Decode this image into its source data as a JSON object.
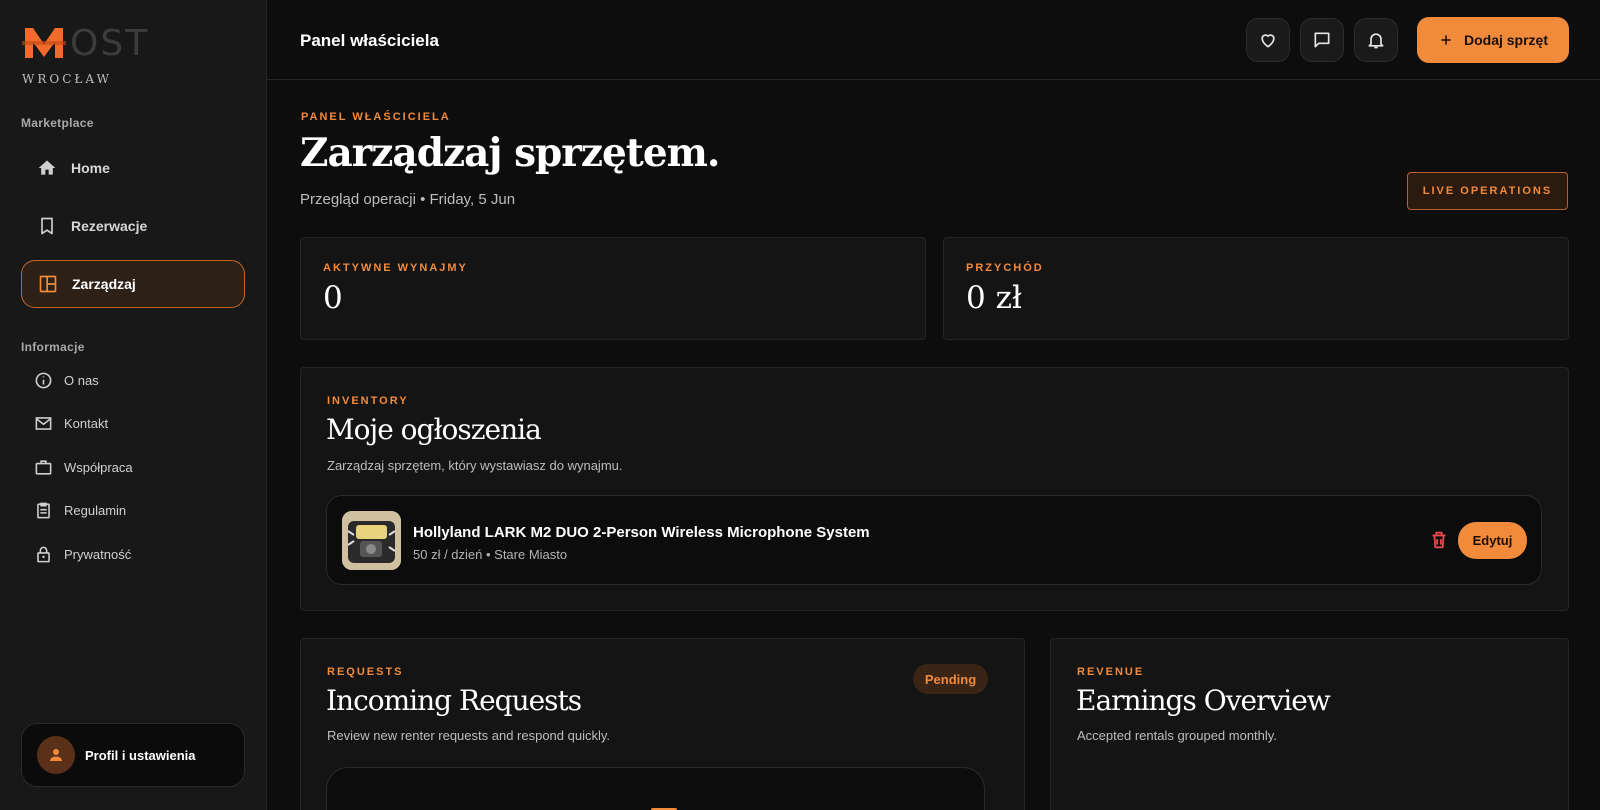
{
  "brand": {
    "logo_text": "OST",
    "city": "WROCŁAW"
  },
  "sidebar": {
    "marketplace_label": "Marketplace",
    "nav": [
      {
        "label": "Home",
        "icon": "home-icon"
      },
      {
        "label": "Rezerwacje",
        "icon": "bookmark-icon"
      },
      {
        "label": "Zarządzaj",
        "icon": "dashboard-icon",
        "active": true
      }
    ],
    "info_label": "Informacje",
    "info_items": [
      {
        "label": "O nas",
        "icon": "info-icon"
      },
      {
        "label": "Kontakt",
        "icon": "mail-icon"
      },
      {
        "label": "Współpraca",
        "icon": "briefcase-icon"
      },
      {
        "label": "Regulamin",
        "icon": "clipboard-icon"
      },
      {
        "label": "Prywatność",
        "icon": "lock-icon"
      }
    ],
    "profile_label": "Profil i ustawienia"
  },
  "topbar": {
    "title": "Panel właściciela",
    "add_button_label": "Dodaj sprzęt"
  },
  "hero": {
    "eyebrow": "PANEL WŁAŚCICIELA",
    "title": "Zarządzaj sprzętem.",
    "subtitle": "Przegląd operacji • Friday, 5 Jun",
    "live_badge": "LIVE OPERATIONS"
  },
  "stats": [
    {
      "label": "AKTYWNE WYNAJMY",
      "value": "0"
    },
    {
      "label": "PRZYCHÓD",
      "value": "0 zł"
    }
  ],
  "inventory": {
    "eyebrow": "INVENTORY",
    "title": "Moje ogłoszenia",
    "description": "Zarządzaj sprzętem, który wystawiasz do wynajmu.",
    "listings": [
      {
        "title": "Hollyland LARK M2 DUO 2-Person Wireless Microphone System",
        "meta": "50 zł / dzień • Stare Miasto",
        "edit_label": "Edytuj"
      }
    ]
  },
  "requests": {
    "eyebrow": "REQUESTS",
    "title": "Incoming Requests",
    "description": "Review new renter requests and respond quickly.",
    "status_badge": "Pending"
  },
  "revenue": {
    "eyebrow": "REVENUE",
    "title": "Earnings Overview",
    "description": "Accepted rentals grouped monthly."
  },
  "colors": {
    "accent": "#f28a3c",
    "background": "#0d0d0d",
    "sidebar": "#181818"
  }
}
